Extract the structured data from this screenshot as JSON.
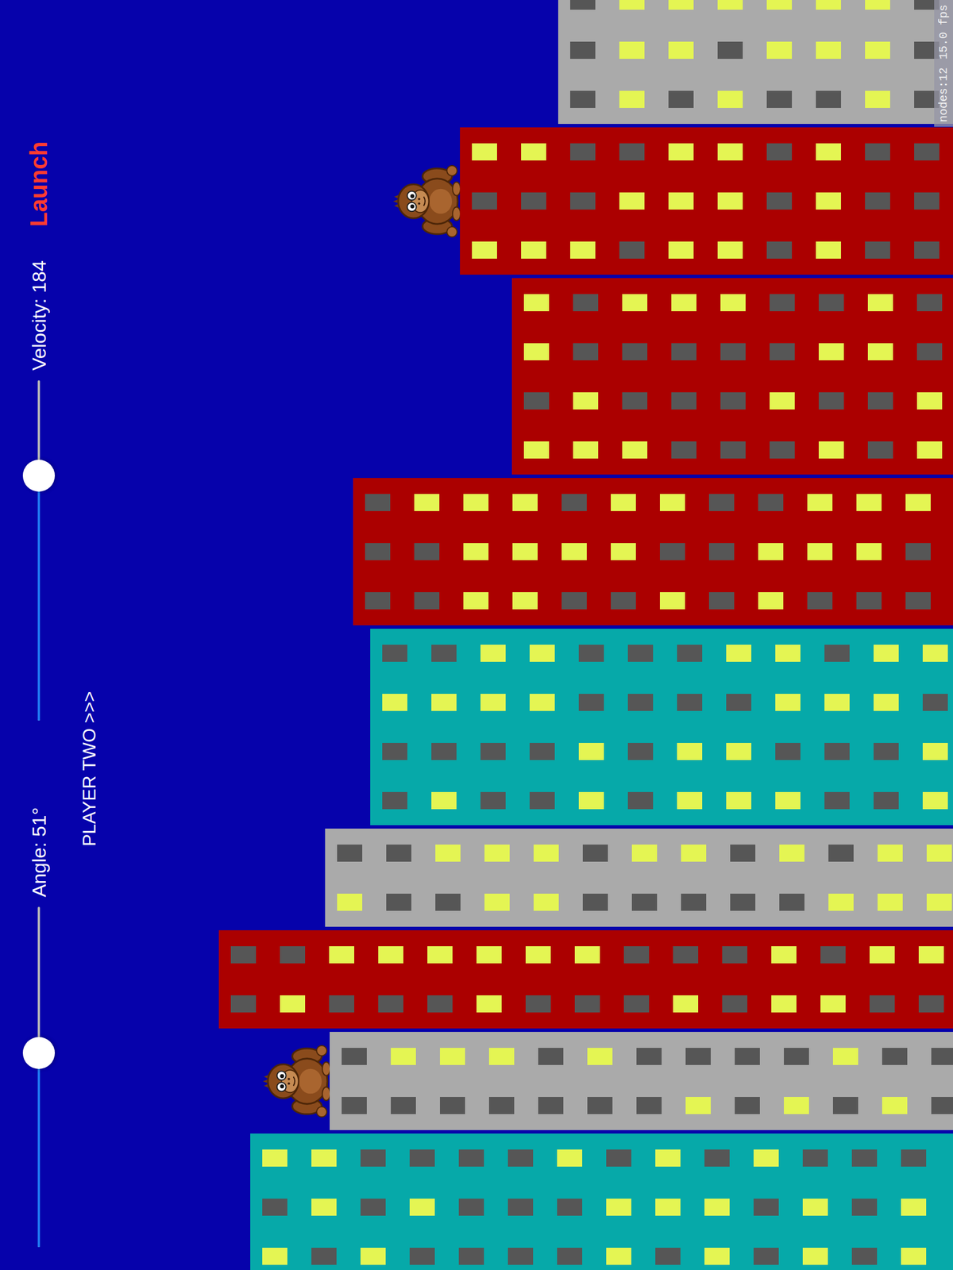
{
  "hud": {
    "angle": {
      "label": "Angle: 51°",
      "level": 0.57
    },
    "velocity": {
      "label": "Velocity: 184",
      "level": 0.72
    },
    "launch_button": "Launch",
    "player_label": "PLAYER TWO >>>"
  },
  "debug": {
    "nodes": "nodes:12",
    "fps": "15.0 fps"
  },
  "buildings": [
    {
      "color": "#aaaaaa",
      "gorilla": false,
      "windows": [
        [
          false,
          true,
          true,
          true,
          true,
          true,
          true,
          false
        ],
        [
          false,
          true,
          true,
          false,
          true,
          true,
          true,
          false
        ],
        [
          false,
          true,
          false,
          true,
          false,
          false,
          true,
          false
        ]
      ]
    },
    {
      "color": "#ab0000",
      "gorilla": true,
      "windows": [
        [
          true,
          true,
          false,
          false,
          true,
          true,
          false,
          true,
          false,
          false
        ],
        [
          false,
          false,
          false,
          true,
          true,
          true,
          false,
          true,
          false,
          false
        ],
        [
          true,
          true,
          true,
          false,
          true,
          true,
          false,
          true,
          false,
          false
        ]
      ]
    },
    {
      "color": "#ab0000",
      "gorilla": false,
      "windows": [
        [
          true,
          false,
          true,
          true,
          true,
          false,
          false,
          true,
          false
        ],
        [
          true,
          false,
          false,
          false,
          false,
          false,
          true,
          true,
          false
        ],
        [
          false,
          true,
          false,
          false,
          false,
          true,
          false,
          false,
          true
        ],
        [
          true,
          true,
          true,
          false,
          false,
          false,
          true,
          false,
          true
        ]
      ]
    },
    {
      "color": "#ab0000",
      "gorilla": false,
      "windows": [
        [
          false,
          true,
          true,
          true,
          false,
          true,
          true,
          false,
          false,
          true,
          true,
          true
        ],
        [
          false,
          false,
          true,
          true,
          true,
          true,
          false,
          false,
          true,
          true,
          true,
          false
        ],
        [
          false,
          false,
          true,
          true,
          false,
          false,
          true,
          false,
          true,
          false,
          false,
          false
        ]
      ]
    },
    {
      "color": "#06a9a9",
      "gorilla": false,
      "windows": [
        [
          false,
          false,
          true,
          true,
          false,
          false,
          false,
          true,
          true,
          false,
          true,
          true
        ],
        [
          true,
          true,
          true,
          true,
          false,
          false,
          false,
          false,
          true,
          true,
          true,
          false
        ],
        [
          false,
          false,
          false,
          false,
          true,
          false,
          true,
          true,
          false,
          false,
          false,
          true
        ],
        [
          false,
          true,
          false,
          false,
          true,
          false,
          true,
          true,
          true,
          false,
          false,
          true
        ]
      ]
    },
    {
      "color": "#aaaaaa",
      "gorilla": false,
      "windows": [
        [
          false,
          false,
          true,
          true,
          true,
          false,
          true,
          true,
          false,
          true,
          false,
          true,
          true
        ],
        [
          true,
          false,
          false,
          true,
          true,
          false,
          false,
          false,
          false,
          false,
          true,
          true,
          true
        ]
      ]
    },
    {
      "color": "#ab0000",
      "gorilla": false,
      "windows": [
        [
          false,
          false,
          true,
          true,
          true,
          true,
          true,
          true,
          false,
          false,
          false,
          true,
          false,
          true,
          true
        ],
        [
          false,
          true,
          false,
          false,
          false,
          true,
          false,
          false,
          false,
          true,
          false,
          true,
          true,
          false,
          false
        ]
      ]
    },
    {
      "color": "#aaaaaa",
      "gorilla": true,
      "windows": [
        [
          false,
          true,
          true,
          true,
          false,
          true,
          false,
          false,
          false,
          false,
          true,
          false,
          false
        ],
        [
          false,
          false,
          false,
          false,
          false,
          false,
          false,
          true,
          false,
          true,
          false,
          true,
          false
        ]
      ]
    },
    {
      "color": "#06a9a9",
      "gorilla": false,
      "windows": [
        [
          true,
          true,
          false,
          false,
          false,
          false,
          true,
          false,
          true,
          false,
          true,
          false,
          false,
          false
        ],
        [
          false,
          true,
          false,
          true,
          false,
          false,
          false,
          true,
          true,
          true,
          false,
          true,
          false,
          true
        ],
        [
          true,
          false,
          true,
          false,
          false,
          false,
          false,
          true,
          false,
          true,
          false,
          true,
          false,
          true
        ]
      ]
    }
  ]
}
